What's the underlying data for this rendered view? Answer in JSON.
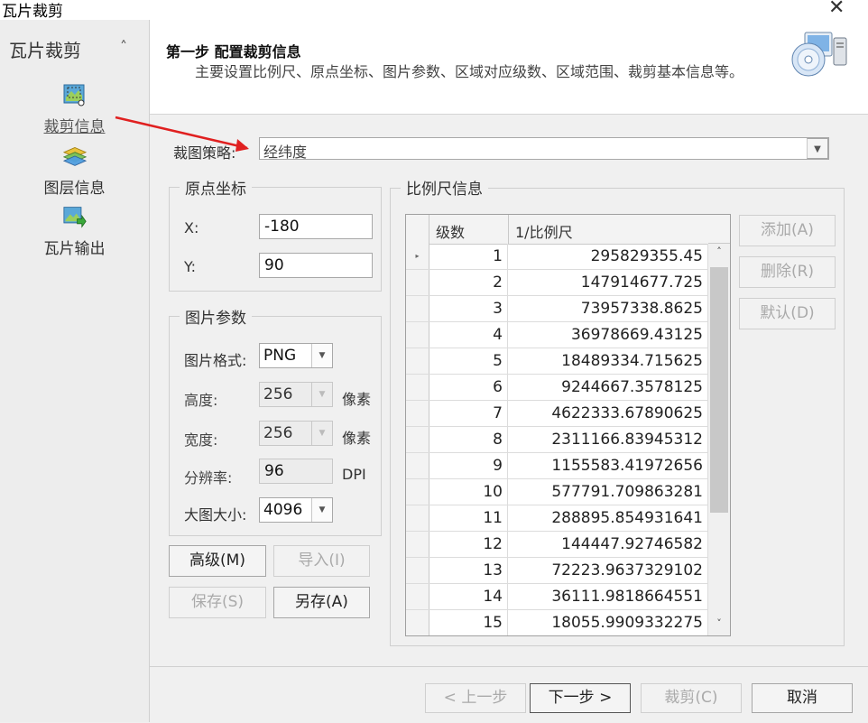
{
  "window": {
    "title": "瓦片裁剪",
    "close_glyph": "✕"
  },
  "sidebar": {
    "header": "瓦片裁剪",
    "collapse_glyph": "˄",
    "items": [
      {
        "label": "裁剪信息",
        "icon": "crop-map-icon"
      },
      {
        "label": "图层信息",
        "icon": "layers-icon"
      },
      {
        "label": "瓦片输出",
        "icon": "tile-export-icon"
      }
    ]
  },
  "header": {
    "step_title": "第一步 配置裁剪信息",
    "step_desc": "主要设置比例尺、原点坐标、图片参数、区域对应级数、区域范围、裁剪基本信息等。",
    "icon": "disc-computer-icon"
  },
  "strategy": {
    "label": "裁图策略:",
    "value": "经纬度"
  },
  "origin": {
    "title": "原点坐标",
    "x_label": "X:",
    "x_value": "-180",
    "y_label": "Y:",
    "y_value": "90"
  },
  "image_params": {
    "title": "图片参数",
    "format_label": "图片格式:",
    "format_value": "PNG",
    "height_label": "高度:",
    "height_value": "256",
    "height_unit": "像素",
    "width_label": "宽度:",
    "width_value": "256",
    "width_unit": "像素",
    "dpi_label": "分辨率:",
    "dpi_value": "96",
    "dpi_unit": "DPI",
    "size_label": "大图大小:",
    "size_value": "4096"
  },
  "left_buttons": {
    "advanced": "高级(M)",
    "import": "导入(I)",
    "save": "保存(S)",
    "save_as": "另存(A)"
  },
  "scale_info": {
    "title": "比例尺信息",
    "columns": [
      "级数",
      "1/比例尺"
    ],
    "rows": [
      [
        "1",
        "295829355.45"
      ],
      [
        "2",
        "147914677.725"
      ],
      [
        "3",
        "73957338.8625"
      ],
      [
        "4",
        "36978669.43125"
      ],
      [
        "5",
        "18489334.715625"
      ],
      [
        "6",
        "9244667.3578125"
      ],
      [
        "7",
        "4622333.67890625"
      ],
      [
        "8",
        "2311166.83945312"
      ],
      [
        "9",
        "1155583.41972656"
      ],
      [
        "10",
        "577791.709863281"
      ],
      [
        "11",
        "288895.854931641"
      ],
      [
        "12",
        "144447.92746582"
      ],
      [
        "13",
        "72223.9637329102"
      ],
      [
        "14",
        "36111.9818664551"
      ],
      [
        "15",
        "18055.9909332275"
      ]
    ],
    "row_indicator": "▸",
    "add": "添加(A)",
    "delete": "删除(R)",
    "default": "默认(D)"
  },
  "footer": {
    "prev": "< 上一步",
    "next": "下一步 >",
    "crop": "裁剪(C)",
    "cancel": "取消"
  },
  "colors": {
    "annotation_arrow": "#e02020",
    "accent_icon": "#3a7bd5"
  }
}
